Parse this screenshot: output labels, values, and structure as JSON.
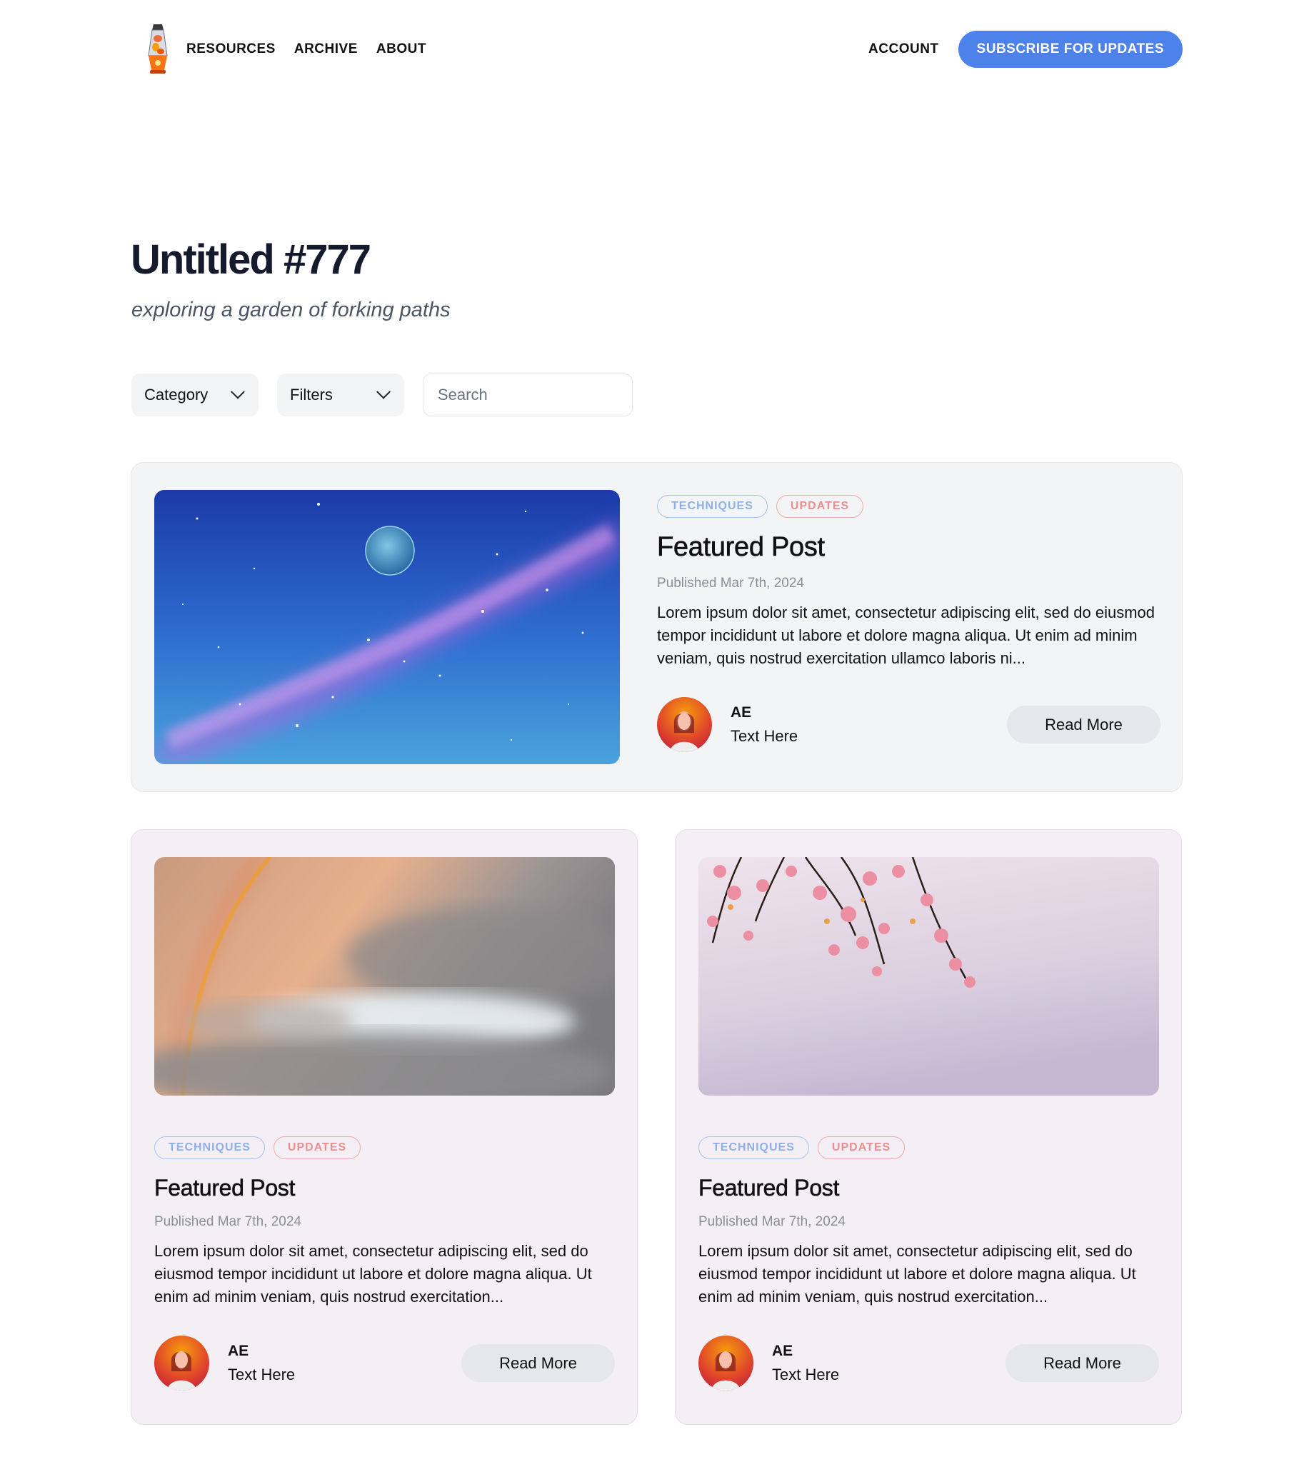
{
  "nav": {
    "links": [
      "RESOURCES",
      "ARCHIVE",
      "ABOUT"
    ],
    "account": "ACCOUNT",
    "subscribe": "SUBSCRIBE FOR UPDATES"
  },
  "header": {
    "title": "Untitled #777",
    "subtitle": "exploring a garden of forking paths"
  },
  "filters": {
    "category": "Category",
    "filters": "Filters",
    "search_placeholder": "Search"
  },
  "colors": {
    "accent": "#4c82ea",
    "tag_techniques": "#8fb0e6",
    "tag_updates": "#ea8f8f",
    "featured_bg": "#f3f4f6",
    "card_bg": "#f3eff4"
  },
  "posts": [
    {
      "tags": [
        "TECHNIQUES",
        "UPDATES"
      ],
      "title": "Featured Post",
      "date": "Published Mar 7th, 2024",
      "excerpt": "Lorem ipsum dolor sit amet, consectetur adipiscing elit, sed do eiusmod tempor incididunt ut labore et dolore magna aliqua. Ut enim ad minim veniam, quis nostrud exercitation ullamco laboris ni...",
      "author": "AE",
      "author_sub": "Text Here",
      "cta": "Read More"
    },
    {
      "tags": [
        "TECHNIQUES",
        "UPDATES"
      ],
      "title": "Featured Post",
      "date": "Published Mar 7th, 2024",
      "excerpt": "Lorem ipsum dolor sit amet, consectetur adipiscing elit, sed do eiusmod tempor incididunt ut labore et dolore magna aliqua. Ut enim ad minim veniam, quis nostrud exercitation...",
      "author": "AE",
      "author_sub": "Text Here",
      "cta": "Read More"
    },
    {
      "tags": [
        "TECHNIQUES",
        "UPDATES"
      ],
      "title": "Featured Post",
      "date": "Published Mar 7th, 2024",
      "excerpt": "Lorem ipsum dolor sit amet, consectetur adipiscing elit, sed do eiusmod tempor incididunt ut labore et dolore magna aliqua. Ut enim ad minim veniam, quis nostrud exercitation...",
      "author": "AE",
      "author_sub": "Text Here",
      "cta": "Read More"
    }
  ]
}
